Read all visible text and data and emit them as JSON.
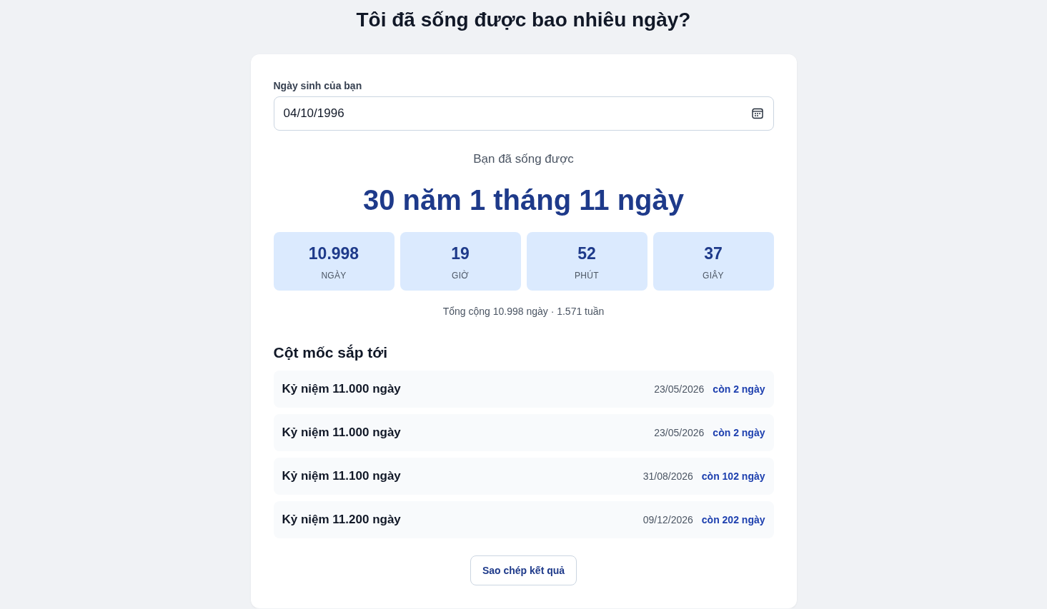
{
  "title": "Tôi đã sống được bao nhiêu ngày?",
  "birth_date": {
    "label": "Ngày sinh của bạn",
    "value": "04/10/1996"
  },
  "result": {
    "caption": "Bạn đã sống được",
    "headline": "30 năm 1 tháng 11 ngày",
    "stats": [
      {
        "value": "10.998",
        "unit": "NGÀY"
      },
      {
        "value": "19",
        "unit": "GIỜ"
      },
      {
        "value": "52",
        "unit": "PHÚT"
      },
      {
        "value": "37",
        "unit": "GIÂY"
      }
    ],
    "summary": "Tổng cộng 10.998 ngày · 1.571 tuần"
  },
  "milestones": {
    "heading": "Cột mốc sắp tới",
    "items": [
      {
        "name": "Kỷ niệm 11.000 ngày",
        "date": "23/05/2026",
        "remaining": "còn 2 ngày"
      },
      {
        "name": "Kỷ niệm 11.000 ngày",
        "date": "23/05/2026",
        "remaining": "còn 2 ngày"
      },
      {
        "name": "Kỷ niệm 11.100 ngày",
        "date": "31/08/2026",
        "remaining": "còn 102 ngày"
      },
      {
        "name": "Kỷ niệm 11.200 ngày",
        "date": "09/12/2026",
        "remaining": "còn 202 ngày"
      }
    ]
  },
  "copy_button": "Sao chép kết quả"
}
